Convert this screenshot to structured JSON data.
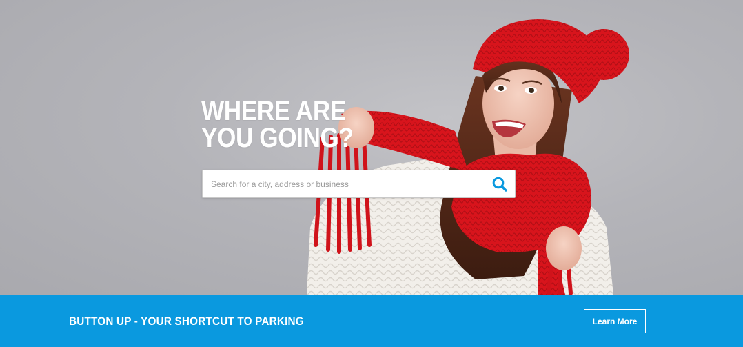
{
  "hero": {
    "headline_line1": "WHERE ARE",
    "headline_line2": "YOU GOING?",
    "search": {
      "placeholder": "Search for a city, address or business",
      "value": "",
      "icon": "search-icon"
    }
  },
  "banner": {
    "tagline": "BUTTON UP - YOUR SHORTCUT TO PARKING",
    "button_label": "Learn More"
  },
  "colors": {
    "banner_bg": "#0a99df",
    "search_icon": "#0a99df",
    "hero_bg": "#b2b2b7",
    "scarf_red": "#d9161d"
  }
}
